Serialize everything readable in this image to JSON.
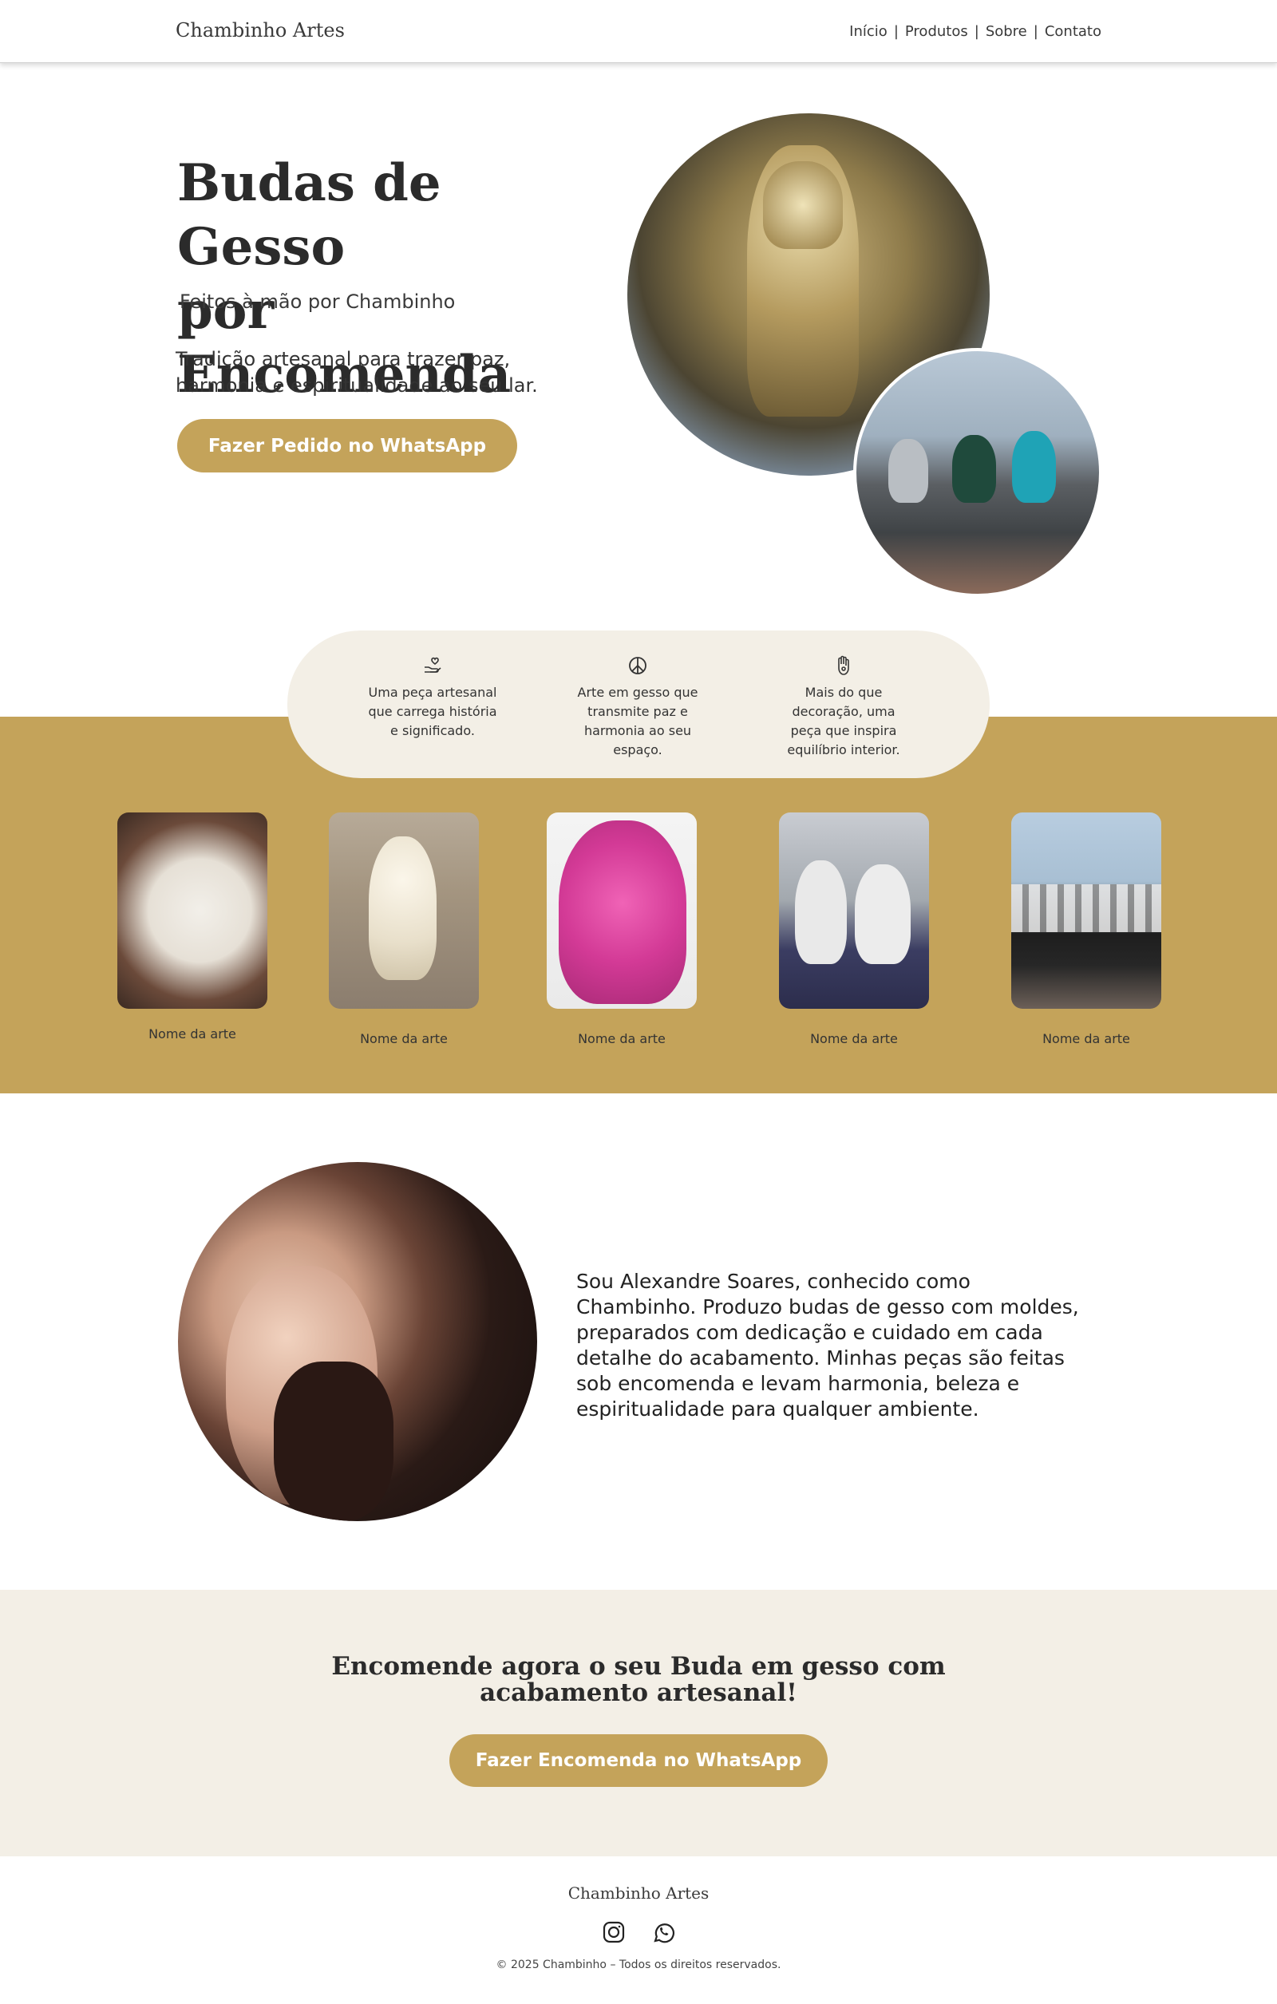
{
  "header": {
    "brand": "Chambinho Artes",
    "nav": [
      "Início",
      "Produtos",
      "Sobre",
      "Contato"
    ],
    "separator": "|"
  },
  "hero": {
    "title_line1": "Budas de Gesso",
    "title_line2": "por Encomenda",
    "subtitle": "Feitos à mão por Chambinho",
    "description": "Tradição artesanal para trazer paz, harmonia e espiritualidade ao seu lar.",
    "button": "Fazer Pedido no WhatsApp"
  },
  "values": [
    {
      "icon": "hand-heart-icon",
      "text": "Uma peça artesanal que carrega história e significado."
    },
    {
      "icon": "peace-icon",
      "text": "Arte em gesso que transmite paz e harmonia ao seu espaço."
    },
    {
      "icon": "hamsa-icon",
      "text": "Mais do que decoração, uma peça que inspira equilíbrio interior."
    }
  ],
  "products": [
    {
      "label": "Nome da arte"
    },
    {
      "label": "Nome da arte"
    },
    {
      "label": "Nome da arte"
    },
    {
      "label": "Nome da arte"
    },
    {
      "label": "Nome da arte"
    }
  ],
  "about": {
    "text": "Sou Alexandre Soares, conhecido como Chambinho. Produzo budas de gesso com moldes, preparados com dedicação e cuidado em cada detalhe do acabamento. Minhas peças são feitas sob encomenda e levam harmonia, beleza e espiritualidade para qualquer ambiente."
  },
  "cta": {
    "title": "Encomende agora o seu Buda em gesso com acabamento artesanal!",
    "button": "Fazer Encomenda no WhatsApp"
  },
  "footer": {
    "brand": "Chambinho Artes",
    "icons": [
      "instagram-icon",
      "whatsapp-icon"
    ],
    "copyright": "© 2025 Chambinho – Todos os direitos reservados."
  },
  "colors": {
    "accent": "#c4a35a",
    "cream": "#f3efe6",
    "text": "#2b2b2b"
  }
}
